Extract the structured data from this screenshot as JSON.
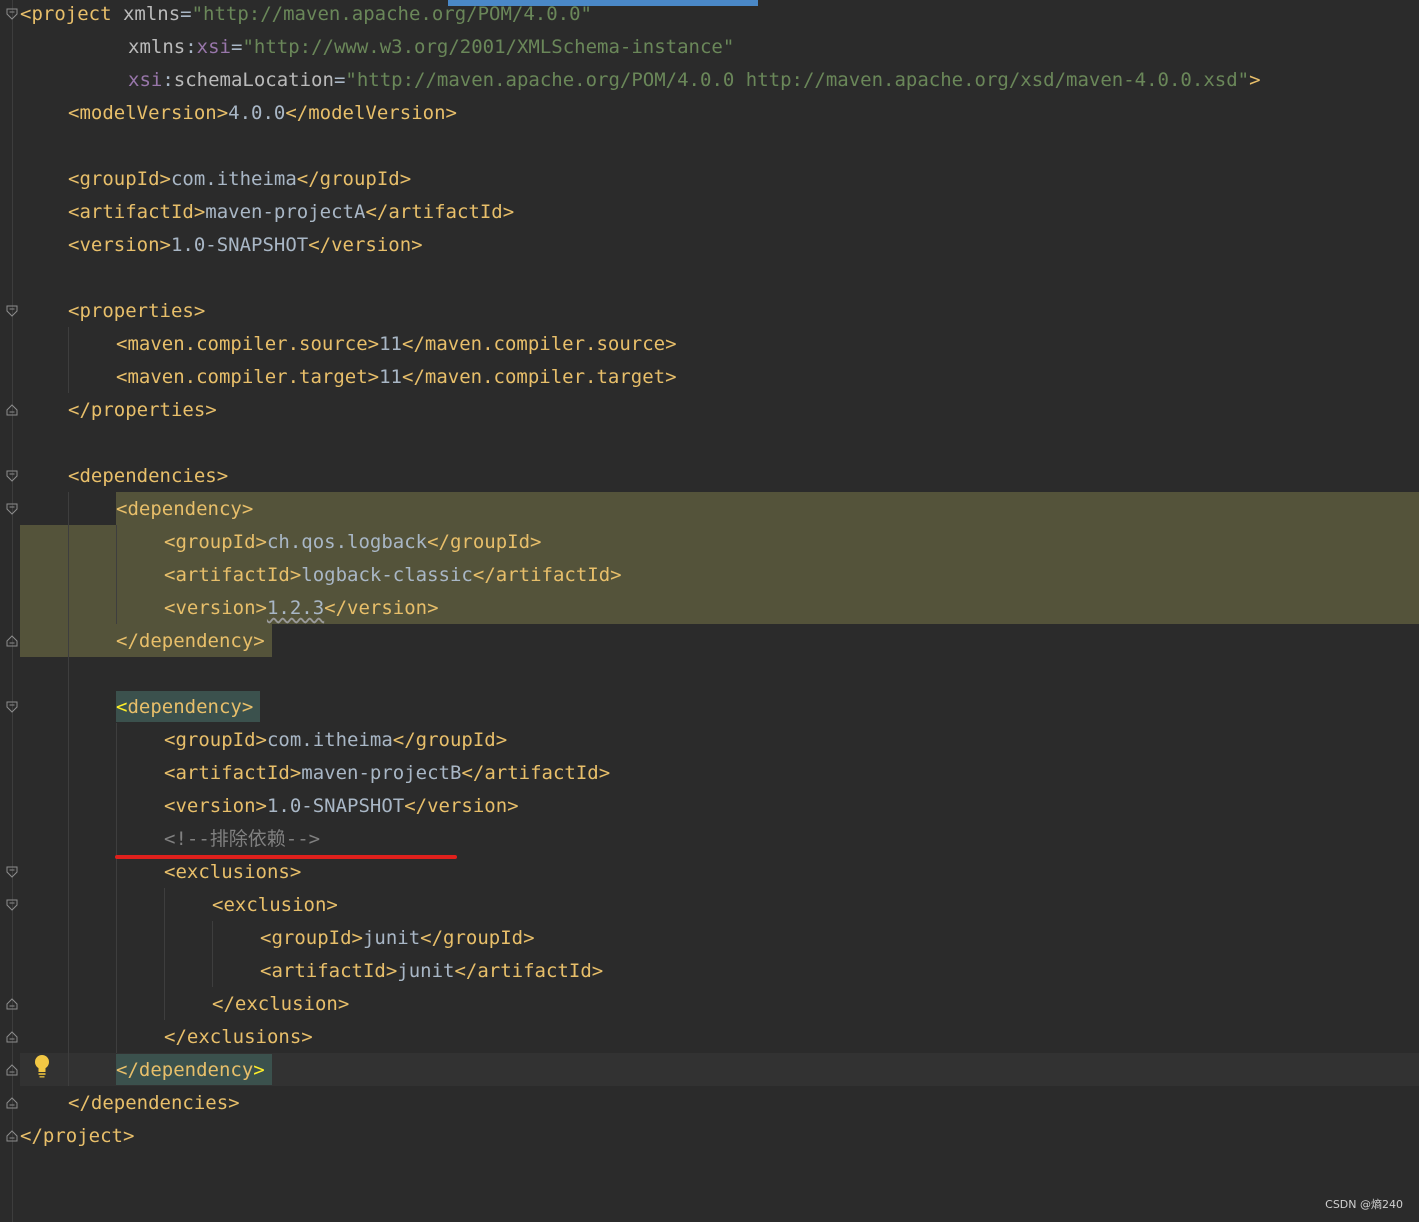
{
  "lines": [
    {
      "indent": 0,
      "parts": [
        {
          "c": "tag",
          "t": "<project "
        },
        {
          "c": "attr",
          "t": "xmlns"
        },
        {
          "c": "txt",
          "t": "="
        },
        {
          "c": "str",
          "t": "\"http://maven.apache.org/POM/4.0.0\""
        }
      ]
    },
    {
      "indent": 9,
      "parts": [
        {
          "c": "attr",
          "t": "xmlns"
        },
        {
          "c": "txt",
          "t": ":"
        },
        {
          "c": "ns",
          "t": "xsi"
        },
        {
          "c": "txt",
          "t": "="
        },
        {
          "c": "str",
          "t": "\"http://www.w3.org/2001/XMLSchema-instance\""
        }
      ]
    },
    {
      "indent": 9,
      "parts": [
        {
          "c": "ns",
          "t": "xsi"
        },
        {
          "c": "txt",
          "t": ":"
        },
        {
          "c": "attr",
          "t": "schemaLocation"
        },
        {
          "c": "txt",
          "t": "="
        },
        {
          "c": "str",
          "t": "\"http://maven.apache.org/POM/4.0.0 http://maven.apache.org/xsd/maven-4.0.0.xsd\""
        },
        {
          "c": "tag",
          "t": ">"
        }
      ]
    },
    {
      "indent": 4,
      "parts": [
        {
          "c": "tag",
          "t": "<modelVersion>"
        },
        {
          "c": "txt",
          "t": "4.0.0"
        },
        {
          "c": "tag",
          "t": "</modelVersion>"
        }
      ]
    },
    {
      "indent": 0,
      "parts": []
    },
    {
      "indent": 4,
      "parts": [
        {
          "c": "tag",
          "t": "<groupId>"
        },
        {
          "c": "txt",
          "t": "com.itheima"
        },
        {
          "c": "tag",
          "t": "</groupId>"
        }
      ]
    },
    {
      "indent": 4,
      "parts": [
        {
          "c": "tag",
          "t": "<artifactId>"
        },
        {
          "c": "txt",
          "t": "maven-projectA"
        },
        {
          "c": "tag",
          "t": "</artifactId>"
        }
      ]
    },
    {
      "indent": 4,
      "parts": [
        {
          "c": "tag",
          "t": "<version>"
        },
        {
          "c": "txt",
          "t": "1.0-SNAPSHOT"
        },
        {
          "c": "tag",
          "t": "</version>"
        }
      ]
    },
    {
      "indent": 0,
      "parts": []
    },
    {
      "indent": 4,
      "parts": [
        {
          "c": "tag",
          "t": "<properties>"
        }
      ]
    },
    {
      "indent": 8,
      "parts": [
        {
          "c": "tag",
          "t": "<maven.compiler.source>"
        },
        {
          "c": "txt",
          "t": "11"
        },
        {
          "c": "tag",
          "t": "</maven.compiler.source>"
        }
      ]
    },
    {
      "indent": 8,
      "parts": [
        {
          "c": "tag",
          "t": "<maven.compiler.target>"
        },
        {
          "c": "txt",
          "t": "11"
        },
        {
          "c": "tag",
          "t": "</maven.compiler.target>"
        }
      ]
    },
    {
      "indent": 4,
      "parts": [
        {
          "c": "tag",
          "t": "</properties>"
        }
      ]
    },
    {
      "indent": 0,
      "parts": []
    },
    {
      "indent": 4,
      "parts": [
        {
          "c": "tag",
          "t": "<dependencies>"
        }
      ]
    },
    {
      "indent": 8,
      "parts": [
        {
          "c": "tag",
          "t": "<dependency>"
        }
      ]
    },
    {
      "indent": 12,
      "parts": [
        {
          "c": "tag",
          "t": "<groupId>"
        },
        {
          "c": "txt",
          "t": "ch.qos.logback"
        },
        {
          "c": "tag",
          "t": "</groupId>"
        }
      ]
    },
    {
      "indent": 12,
      "parts": [
        {
          "c": "tag",
          "t": "<artifactId>"
        },
        {
          "c": "txt",
          "t": "logback-classic"
        },
        {
          "c": "tag",
          "t": "</artifactId>"
        }
      ]
    },
    {
      "indent": 12,
      "parts": [
        {
          "c": "tag",
          "t": "<version>"
        },
        {
          "c": "txt squiggle",
          "t": "1.2.3"
        },
        {
          "c": "tag",
          "t": "</version>"
        }
      ]
    },
    {
      "indent": 8,
      "parts": [
        {
          "c": "tag",
          "t": "</dependency>"
        }
      ]
    },
    {
      "indent": 0,
      "parts": []
    },
    {
      "indent": 8,
      "parts": [
        {
          "c": "hl-yellow",
          "t": "<"
        },
        {
          "c": "tag",
          "t": "dependency>"
        }
      ]
    },
    {
      "indent": 12,
      "parts": [
        {
          "c": "tag",
          "t": "<groupId>"
        },
        {
          "c": "txt",
          "t": "com.itheima"
        },
        {
          "c": "tag",
          "t": "</groupId>"
        }
      ]
    },
    {
      "indent": 12,
      "parts": [
        {
          "c": "tag",
          "t": "<artifactId>"
        },
        {
          "c": "txt",
          "t": "maven-projectB"
        },
        {
          "c": "tag",
          "t": "</artifactId>"
        }
      ]
    },
    {
      "indent": 12,
      "parts": [
        {
          "c": "tag",
          "t": "<version>"
        },
        {
          "c": "txt",
          "t": "1.0-SNAPSHOT"
        },
        {
          "c": "tag",
          "t": "</version>"
        }
      ]
    },
    {
      "indent": 12,
      "parts": [
        {
          "c": "cmt",
          "t": "<!--排除依赖-->"
        }
      ]
    },
    {
      "indent": 12,
      "parts": [
        {
          "c": "tag",
          "t": "<exclusions>"
        }
      ]
    },
    {
      "indent": 16,
      "parts": [
        {
          "c": "tag",
          "t": "<exclusion>"
        }
      ]
    },
    {
      "indent": 20,
      "parts": [
        {
          "c": "tag",
          "t": "<groupId>"
        },
        {
          "c": "txt",
          "t": "junit"
        },
        {
          "c": "tag",
          "t": "</groupId>"
        }
      ]
    },
    {
      "indent": 20,
      "parts": [
        {
          "c": "tag",
          "t": "<artifactId>"
        },
        {
          "c": "txt",
          "t": "junit"
        },
        {
          "c": "tag",
          "t": "</artifactId>"
        }
      ]
    },
    {
      "indent": 16,
      "parts": [
        {
          "c": "tag",
          "t": "</exclusion>"
        }
      ]
    },
    {
      "indent": 12,
      "parts": [
        {
          "c": "tag",
          "t": "</exclusions>"
        }
      ]
    },
    {
      "indent": 8,
      "parts": [
        {
          "c": "tag",
          "t": "</dependency"
        },
        {
          "c": "hl-yellow",
          "t": ">"
        }
      ]
    },
    {
      "indent": 4,
      "parts": [
        {
          "c": "tag",
          "t": "</dependencies>"
        }
      ]
    },
    {
      "indent": 0,
      "parts": [
        {
          "c": "tag",
          "t": "</project>"
        }
      ]
    }
  ],
  "folds": [
    {
      "row": 0,
      "kind": "open"
    },
    {
      "row": 9,
      "kind": "open"
    },
    {
      "row": 12,
      "kind": "close"
    },
    {
      "row": 14,
      "kind": "open"
    },
    {
      "row": 15,
      "kind": "open"
    },
    {
      "row": 19,
      "kind": "close"
    },
    {
      "row": 21,
      "kind": "open"
    },
    {
      "row": 26,
      "kind": "open"
    },
    {
      "row": 27,
      "kind": "open"
    },
    {
      "row": 30,
      "kind": "close"
    },
    {
      "row": 31,
      "kind": "close"
    },
    {
      "row": 32,
      "kind": "close"
    },
    {
      "row": 33,
      "kind": "close"
    },
    {
      "row": 34,
      "kind": "close"
    }
  ],
  "icons": {
    "intention_bulb": "lightbulb-icon",
    "fold_marker": "fold-arrow-icon"
  },
  "colors": {
    "background": "#2b2b2b",
    "tag": "#e8bf6a",
    "string": "#6a8759",
    "comment": "#808080",
    "highlight_block": "#54533a",
    "annotation_underline": "#e0201c"
  },
  "watermark": "CSDN @熵240"
}
